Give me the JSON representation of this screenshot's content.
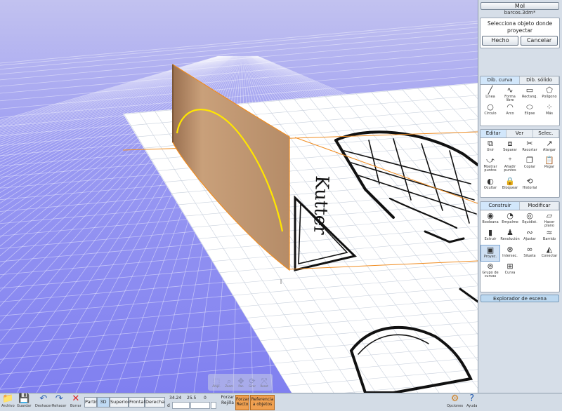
{
  "header": {
    "app_button": "MoI",
    "filename": "barcos.3dm*"
  },
  "prompt": {
    "text": "Selecciona objeto donde proyectar",
    "done": "Hecho",
    "cancel": "Cancelar"
  },
  "draw_section": {
    "tabs": [
      "Dib. curva",
      "Dib. sólido"
    ],
    "tools": [
      {
        "label": "Línea",
        "icon": "line-icon",
        "glyph": "╱"
      },
      {
        "label": "Forma libre",
        "icon": "freeform-icon",
        "glyph": "∿"
      },
      {
        "label": "Rectang.",
        "icon": "rectangle-icon",
        "glyph": "▭"
      },
      {
        "label": "Polígono",
        "icon": "polygon-icon",
        "glyph": "⬠"
      },
      {
        "label": "Círculo",
        "icon": "circle-icon",
        "glyph": "○"
      },
      {
        "label": "Arco",
        "icon": "arc-icon",
        "glyph": "◠"
      },
      {
        "label": "Elipse",
        "icon": "ellipse-icon",
        "glyph": "⬭"
      },
      {
        "label": "Más",
        "icon": "more-icon",
        "glyph": "⁘"
      }
    ]
  },
  "edit_section": {
    "tabs": [
      "Editar",
      "Ver",
      "Selec."
    ],
    "tools": [
      {
        "label": "Unir",
        "icon": "join-icon",
        "glyph": "⧉"
      },
      {
        "label": "Separar",
        "icon": "separate-icon",
        "glyph": "⧈"
      },
      {
        "label": "Recortar",
        "icon": "trim-icon",
        "glyph": "✂"
      },
      {
        "label": "Alargar",
        "icon": "extend-icon",
        "glyph": "↗"
      },
      {
        "label": "Mostrar puntos",
        "icon": "show-points-icon",
        "glyph": "⤻"
      },
      {
        "label": "Añadir puntos",
        "icon": "add-points-icon",
        "glyph": "⁺"
      },
      {
        "label": "Copiar",
        "icon": "copy-icon",
        "glyph": "❐"
      },
      {
        "label": "Pegar",
        "icon": "paste-icon",
        "glyph": "📋"
      },
      {
        "label": "Ocultar",
        "icon": "hide-icon",
        "glyph": "◐"
      },
      {
        "label": "Bloquear",
        "icon": "lock-icon",
        "glyph": "🔒"
      },
      {
        "label": "Historial",
        "icon": "history-icon",
        "glyph": "⟲"
      }
    ]
  },
  "construct_section": {
    "tabs": [
      "Construir",
      "Modificar"
    ],
    "tools": [
      {
        "label": "Booleana",
        "icon": "boolean-icon",
        "glyph": "◉"
      },
      {
        "label": "Empalme",
        "icon": "fillet-icon",
        "glyph": "◔"
      },
      {
        "label": "Equidist.",
        "icon": "offset-icon",
        "glyph": "◎"
      },
      {
        "label": "Hacer plano",
        "icon": "planar-icon",
        "glyph": "▱"
      },
      {
        "label": "Extruir",
        "icon": "extrude-icon",
        "glyph": "▮"
      },
      {
        "label": "Revolución",
        "icon": "revolve-icon",
        "glyph": "♟"
      },
      {
        "label": "Ajustar",
        "icon": "sweep-icon",
        "glyph": "∾"
      },
      {
        "label": "Barrido",
        "icon": "loft-icon",
        "glyph": "≈"
      },
      {
        "label": "Proyec.",
        "icon": "project-icon",
        "glyph": "▣"
      },
      {
        "label": "Intersec.",
        "icon": "intersect-icon",
        "glyph": "⊗"
      },
      {
        "label": "Silueta",
        "icon": "silhouette-icon",
        "glyph": "∞"
      },
      {
        "label": "Conectar",
        "icon": "connect-icon",
        "glyph": "◭"
      },
      {
        "label": "Grupo de curvas",
        "icon": "curve-group-icon",
        "glyph": "⊚"
      },
      {
        "label": "Curva",
        "icon": "curve-icon",
        "glyph": "⊞"
      }
    ]
  },
  "explorer": {
    "label": "Explorador de escena"
  },
  "viewport": {
    "nav": [
      {
        "label": "Ampl.",
        "icon": "zoom-window-icon",
        "glyph": "⬚"
      },
      {
        "label": "Zoom",
        "icon": "zoom-icon",
        "glyph": "⌕"
      },
      {
        "label": "Pan",
        "icon": "pan-icon",
        "glyph": "✥"
      },
      {
        "label": "Girar",
        "icon": "orbit-icon",
        "glyph": "⟳"
      },
      {
        "label": "Reset",
        "icon": "reset-icon",
        "glyph": "⤧"
      }
    ]
  },
  "bottom": {
    "file": [
      {
        "label": "Archivo",
        "icon": "folder-icon",
        "glyph": "📁"
      },
      {
        "label": "Guardar",
        "icon": "save-icon",
        "glyph": "💾"
      },
      {
        "label": "Deshacer",
        "icon": "undo-icon",
        "glyph": "↶"
      },
      {
        "label": "Rehacer",
        "icon": "redo-icon",
        "glyph": "↷"
      },
      {
        "label": "Borrar",
        "icon": "delete-icon",
        "glyph": "✕"
      }
    ],
    "views": [
      "Partir",
      "3D",
      "Superior",
      "Frontal",
      "Derecha"
    ],
    "coords": {
      "x": "34.24",
      "y": "25.5",
      "z": "0",
      "d_label": "d"
    },
    "snap_labels": {
      "force": "Forzar",
      "grid": "Rejilla"
    },
    "snap_buttons": [
      {
        "line1": "Forzar",
        "line2": "Recto"
      },
      {
        "line1": "Referencia",
        "line2": "a objetos"
      }
    ],
    "right": [
      {
        "label": "Opciones",
        "icon": "options-icon",
        "glyph": "⚙"
      },
      {
        "label": "Ayuda",
        "icon": "help-icon",
        "glyph": "?"
      }
    ]
  }
}
